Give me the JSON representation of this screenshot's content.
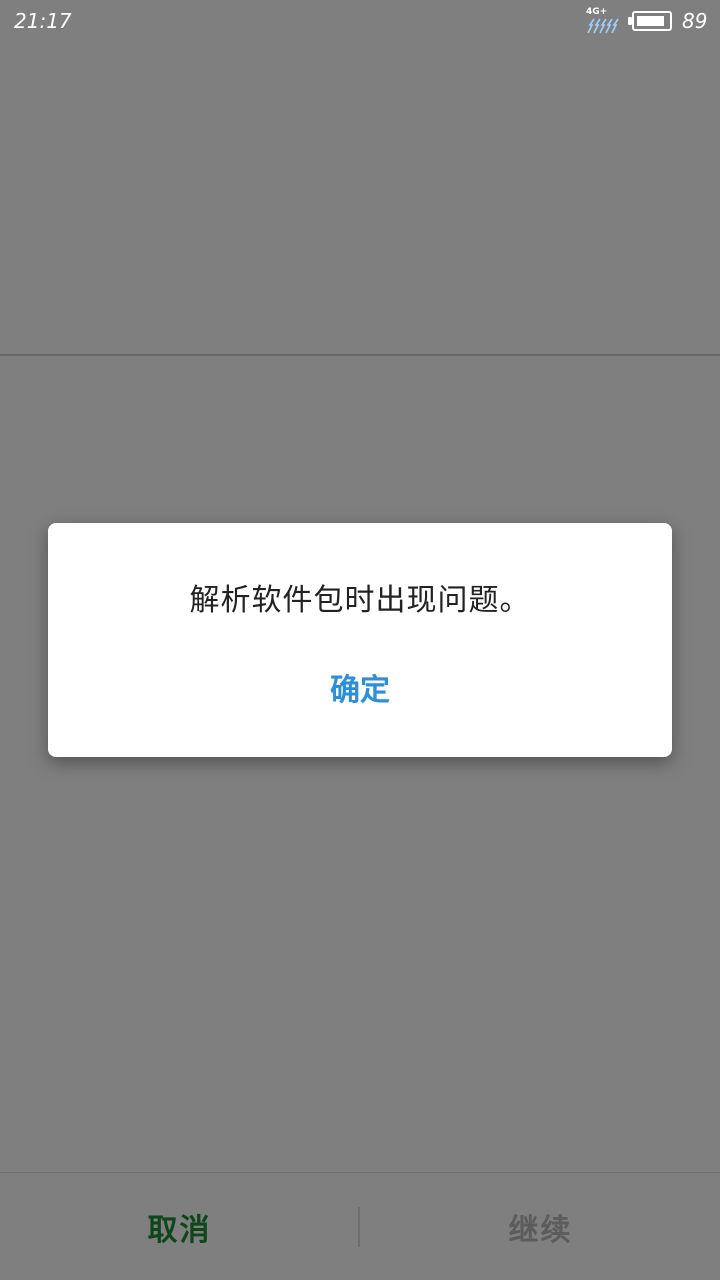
{
  "status_bar": {
    "time": "21:17",
    "network": "4G+",
    "battery_level": "89",
    "battery_fraction": 0.89,
    "icon_color": "#ffffff"
  },
  "dialog": {
    "message": "解析软件包时出现问题。",
    "confirm_label": "确定",
    "confirm_color": "#2b8fdb"
  },
  "bottom_bar": {
    "cancel_label": "取消",
    "continue_label": "继续",
    "cancel_color": "#1f8f3a",
    "continue_color": "#b8b8b8"
  },
  "overlay": {
    "scrim_color": "rgba(0,0,0,0.5)"
  }
}
